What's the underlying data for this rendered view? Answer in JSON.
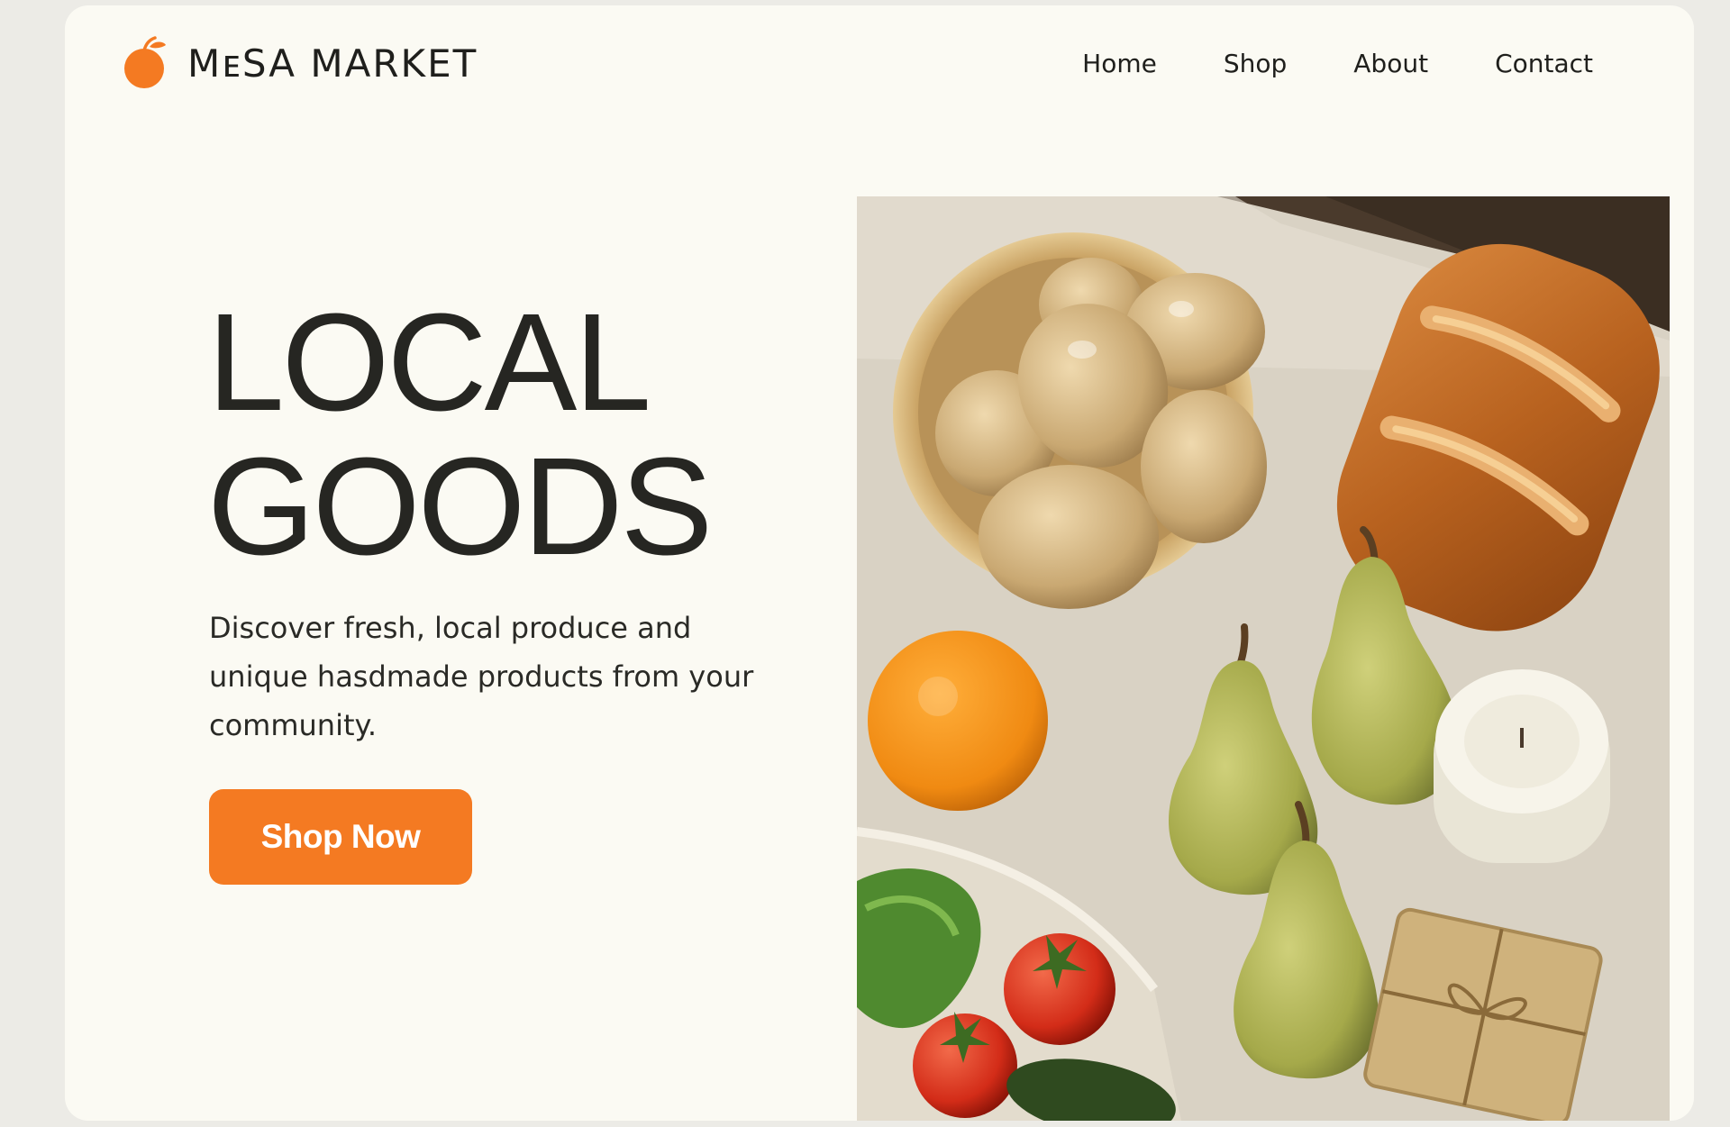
{
  "brand": {
    "name": "MᴇSA MARKET",
    "accent_color": "#f47a22"
  },
  "nav": {
    "items": [
      "Home",
      "Shop",
      "About",
      "Contact"
    ]
  },
  "hero": {
    "title_line1": "LOCAL",
    "title_line2": "GOODS",
    "description": "Discover fresh, local produce and unique hasdmade products from your community.",
    "cta_label": "Shop Now"
  },
  "image": {
    "subject": "local produce still life",
    "items": [
      "bowl-of-potatoes",
      "bread-loaf",
      "orange",
      "pears",
      "candle",
      "wrapped-soap",
      "vegetable-bag"
    ]
  }
}
